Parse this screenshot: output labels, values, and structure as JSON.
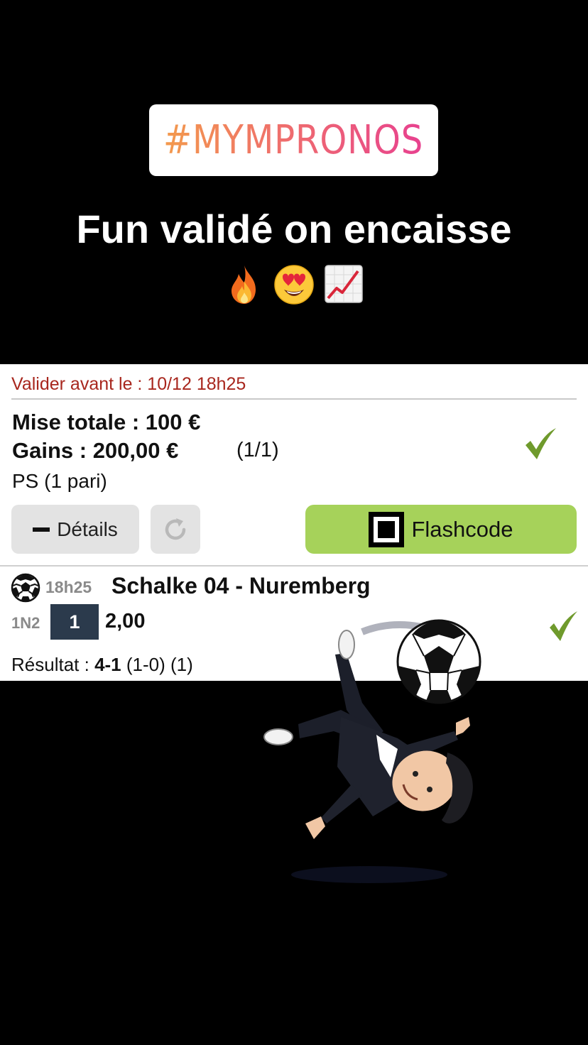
{
  "story": {
    "hashtag": "#MYMPRONOS",
    "caption": "Fun validé on encaisse",
    "emojis": [
      "fire-emoji",
      "heart-eyes-emoji",
      "chart-increasing-emoji"
    ]
  },
  "bet": {
    "deadline": "Valider avant le : 10/12 18h25",
    "stake": "Mise totale : 100 €",
    "gains": "Gains : 200,00 €",
    "gains_ratio": "(1/1)",
    "bet_type": "PS (1 pari)",
    "status_icon": "check-icon",
    "details_label": "Détails",
    "flashcode_label": "Flashcode"
  },
  "match": {
    "sport_icon": "soccer-ball-icon",
    "time": "18h25",
    "name": "Schalke 04 - Nuremberg",
    "market": "1N2",
    "pick": "1",
    "odds": "2,00",
    "result_prefix": "Résultat : ",
    "score": "4-1",
    "result_suffix": " (1-0) (1)",
    "status_icon": "check-icon"
  },
  "colors": {
    "deadline": "#a8271e",
    "accept": "#a6d25a",
    "check": "#6f9a2c",
    "pick_bg": "#2b3a4c"
  }
}
